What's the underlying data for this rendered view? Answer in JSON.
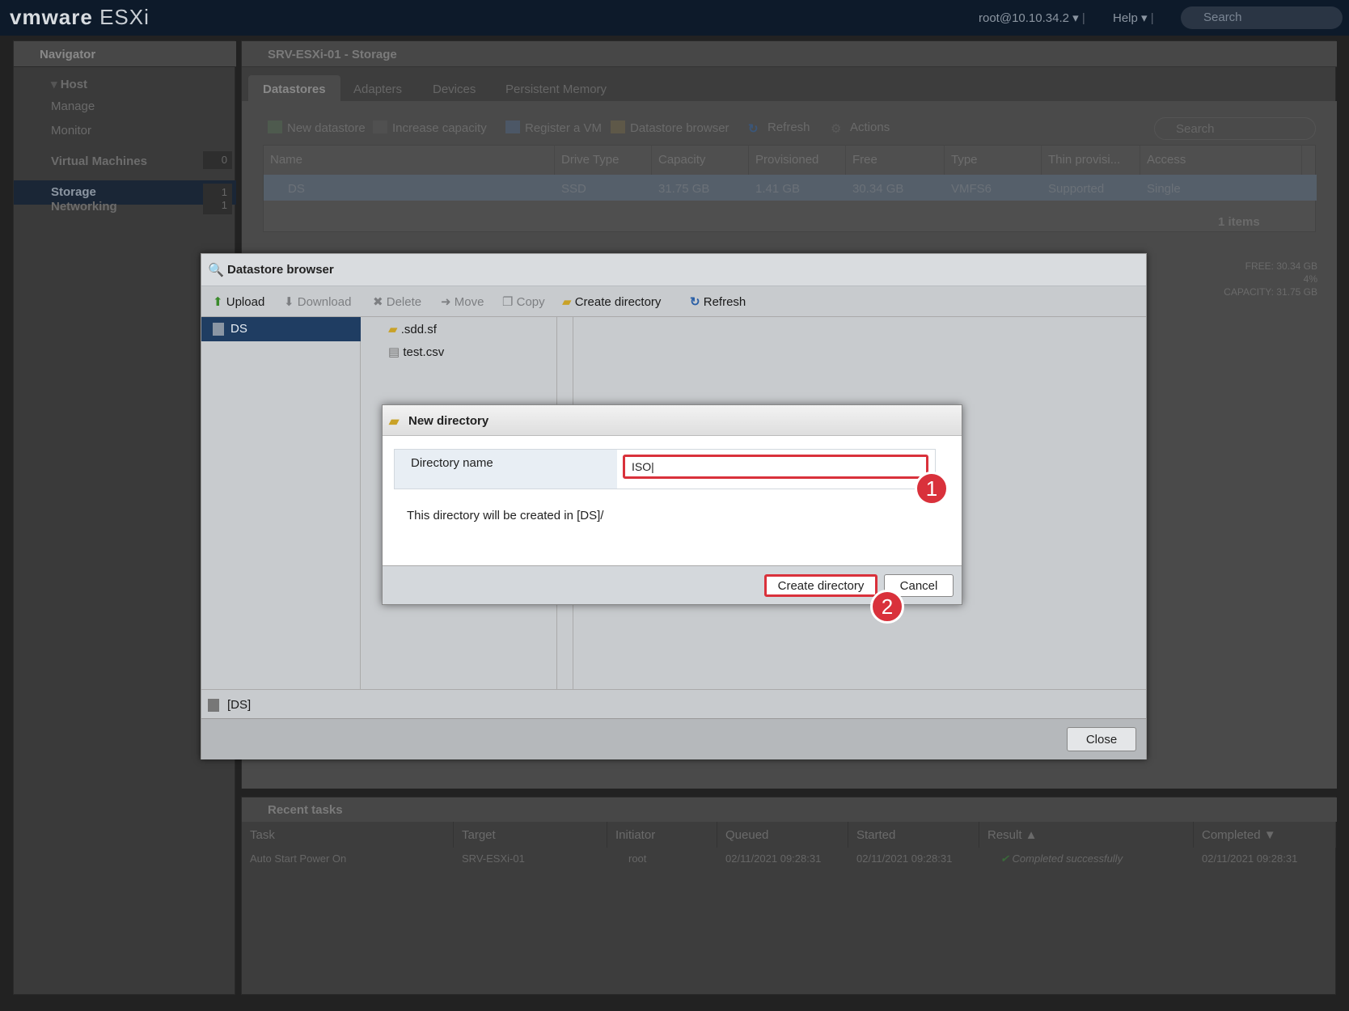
{
  "header": {
    "brand": "vmware",
    "product": "ESXi",
    "user": "root@10.10.34.2",
    "help": "Help",
    "search_placeholder": "Search"
  },
  "navigator": {
    "title": "Navigator",
    "host": "Host",
    "manage": "Manage",
    "monitor": "Monitor",
    "vms": "Virtual Machines",
    "vms_count": "0",
    "storage": "Storage",
    "storage_count": "1",
    "networking": "Networking",
    "networking_count": "1"
  },
  "main": {
    "title": "SRV-ESXi-01 - Storage",
    "tabs": [
      "Datastores",
      "Adapters",
      "Devices",
      "Persistent Memory"
    ],
    "toolbar": [
      "New datastore",
      "Increase capacity",
      "Register a VM",
      "Datastore browser",
      "Refresh",
      "Actions"
    ],
    "search_placeholder": "Search",
    "columns": [
      "Name",
      "Drive Type",
      "Capacity",
      "Provisioned",
      "Free",
      "Type",
      "Thin provisi...",
      "Access"
    ],
    "row": [
      "DS",
      "SSD",
      "31.75 GB",
      "1.41 GB",
      "30.34 GB",
      "VMFS6",
      "Supported",
      "Single"
    ],
    "items": "1 items",
    "free": "FREE: 30.34 GB",
    "pct": "4%",
    "capacity": "CAPACITY: 31.75 GB"
  },
  "recent": {
    "title": "Recent tasks",
    "columns": [
      "Task",
      "Target",
      "Initiator",
      "Queued",
      "Started",
      "Result ▲",
      "Completed ▼"
    ],
    "row": [
      "Auto Start Power On",
      "SRV-ESXi-01",
      "root",
      "02/11/2021 09:28:31",
      "02/11/2021 09:28:31",
      "Completed successfully",
      "02/11/2021 09:28:31"
    ]
  },
  "dsbrowser": {
    "title": "Datastore browser",
    "toolbar": {
      "upload": "Upload",
      "download": "Download",
      "delete": "Delete",
      "move": "Move",
      "copy": "Copy",
      "create": "Create directory",
      "refresh": "Refresh"
    },
    "datastore": "DS",
    "files": [
      ".sdd.sf",
      "test.csv"
    ],
    "path": "[DS]",
    "close": "Close"
  },
  "newdir": {
    "title": "New directory",
    "label": "Directory name",
    "value": "ISO",
    "info": "This directory will be created in [DS]/",
    "create": "Create directory",
    "cancel": "Cancel",
    "step1": "1",
    "step2": "2"
  },
  "colors": {
    "accent_red": "#d9313b",
    "selection_blue": "#1f3d62"
  }
}
